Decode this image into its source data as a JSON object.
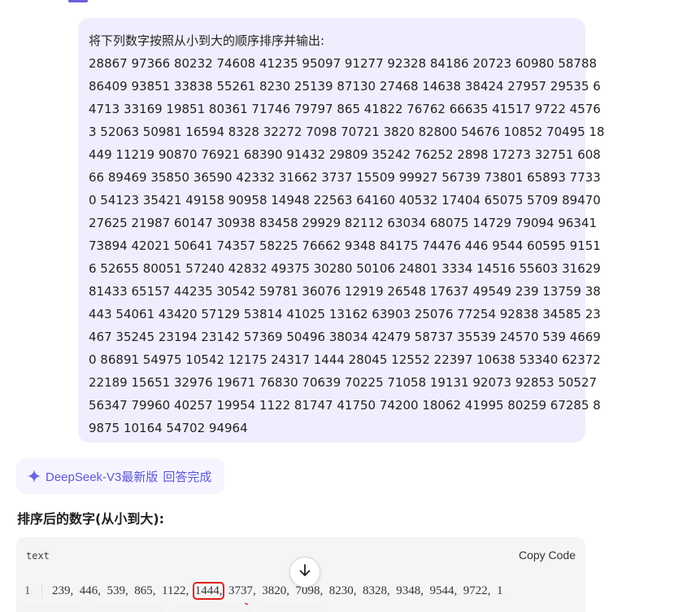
{
  "user_message": {
    "prompt": "将下列数字按照从小到大的顺序排序并输出:",
    "lines": [
      "28867 97366 80232 74608 41235 95097 91277 92328 84186 20723 60980 58788",
      "86409 93851 33838 55261 8230 25139 87130 27468 14638 38424 27957 29535 6",
      "4713 33169 19851 80361 71746 79797 865 41822 76762 66635 41517 9722 4576",
      "3 52063 50981 16594 8328 32272 7098 70721 3820 82800 54676 10852 70495 18",
      "449 11219 90870 76921 68390 91432 29809 35242 76252 2898 17273 32751 608",
      "66 89469 35850 36590 42332 31662 3737 15509 99927 56739 73801 65893 7733",
      "0 54123 35421 49158 90958 14948 22563 64160 40532 17404 65075 5709 89470",
      "27625 21987 60147 30938 83458 29929 82112 63034 68075 14729 79094 96341",
      "73894 42021 50641 74357 58225 76662 9348 84175 74476 446 9544 60595 9151",
      "6 52655 80051 57240 42832 49375 30280 50106 24801 3334 14516 55603 31629",
      "81433 65157 44235 30542 59781 36076 12919 26548 17637 49549 239 13759 38",
      "443 54061 43420 57129 53814 41025 13162 63903 25076 77254 92838 34585 23",
      "467 35245 23194 23142 57369 50496 38034 42479 58737 35539 24570 539 4669",
      "0 86891 54975 10542 12175 24317 1444 28045 12552 22397 10638 53340 62372",
      "22189 15651 32976 19671 76830 70639 70225 71058 19131 92073 92853 50527",
      "56347 79960 40257 19954 1122 81747 41750 74200 18062 41995 80259 67285 8",
      "9875 10164 54702 94964"
    ]
  },
  "model_status": {
    "icon": "sparkle-icon",
    "model_name": "DeepSeek-V3最新版",
    "status": "回答完成",
    "accent_color": "#5b57d1"
  },
  "answer": {
    "heading": "排序后的数字(从小到大):",
    "code_block": {
      "language": "text",
      "copy_label": "Copy Code",
      "line_number": "1",
      "tokens": [
        "239,",
        "446,",
        "539,",
        "865,",
        "1122,",
        "1444,",
        "3737,",
        "3820,",
        "7098,",
        "8230,",
        "8328,",
        "9348,",
        "9544,",
        "9722,",
        "1"
      ],
      "highlighted_token": "1444,",
      "highlight_color": "#e0201b"
    }
  },
  "scroll_button": {
    "icon": "arrow-down-icon"
  }
}
